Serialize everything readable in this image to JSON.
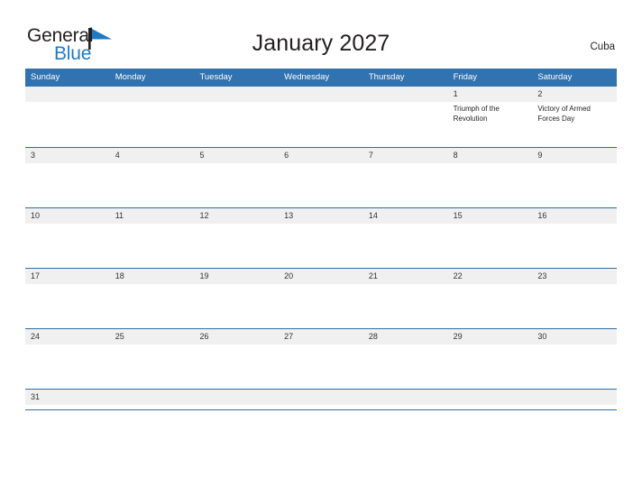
{
  "brand": {
    "name_part1": "General",
    "name_part2": "Blue",
    "flag_color": "#1f7ac4",
    "text_color": "#231f20"
  },
  "header": {
    "title": "January 2027",
    "region": "Cuba"
  },
  "theme": {
    "header_blue": "#3172b0",
    "separator_blue": "#2e6da4",
    "date_band_gray": "#f0f0f0",
    "page_background": "#ffffff",
    "text_color": "#231f20"
  },
  "calendar": {
    "month": "January",
    "year": "2027",
    "weekdays": [
      "Sunday",
      "Monday",
      "Tuesday",
      "Wednesday",
      "Thursday",
      "Friday",
      "Saturday"
    ],
    "weeks": [
      {
        "days": [
          {
            "number": "",
            "events": []
          },
          {
            "number": "",
            "events": []
          },
          {
            "number": "",
            "events": []
          },
          {
            "number": "",
            "events": []
          },
          {
            "number": "",
            "events": []
          },
          {
            "number": "1",
            "events": [
              "Triumph of the Revolution"
            ]
          },
          {
            "number": "2",
            "events": [
              "Victory of Armed Forces Day"
            ]
          }
        ]
      },
      {
        "days": [
          {
            "number": "3",
            "events": []
          },
          {
            "number": "4",
            "events": []
          },
          {
            "number": "5",
            "events": []
          },
          {
            "number": "6",
            "events": []
          },
          {
            "number": "7",
            "events": []
          },
          {
            "number": "8",
            "events": []
          },
          {
            "number": "9",
            "events": []
          }
        ]
      },
      {
        "days": [
          {
            "number": "10",
            "events": []
          },
          {
            "number": "11",
            "events": []
          },
          {
            "number": "12",
            "events": []
          },
          {
            "number": "13",
            "events": []
          },
          {
            "number": "14",
            "events": []
          },
          {
            "number": "15",
            "events": []
          },
          {
            "number": "16",
            "events": []
          }
        ]
      },
      {
        "days": [
          {
            "number": "17",
            "events": []
          },
          {
            "number": "18",
            "events": []
          },
          {
            "number": "19",
            "events": []
          },
          {
            "number": "20",
            "events": []
          },
          {
            "number": "21",
            "events": []
          },
          {
            "number": "22",
            "events": []
          },
          {
            "number": "23",
            "events": []
          }
        ]
      },
      {
        "days": [
          {
            "number": "24",
            "events": []
          },
          {
            "number": "25",
            "events": []
          },
          {
            "number": "26",
            "events": []
          },
          {
            "number": "27",
            "events": []
          },
          {
            "number": "28",
            "events": []
          },
          {
            "number": "29",
            "events": []
          },
          {
            "number": "30",
            "events": []
          }
        ]
      },
      {
        "days": [
          {
            "number": "31",
            "events": []
          },
          {
            "number": "",
            "events": []
          },
          {
            "number": "",
            "events": []
          },
          {
            "number": "",
            "events": []
          },
          {
            "number": "",
            "events": []
          },
          {
            "number": "",
            "events": []
          },
          {
            "number": "",
            "events": []
          }
        ]
      }
    ]
  }
}
